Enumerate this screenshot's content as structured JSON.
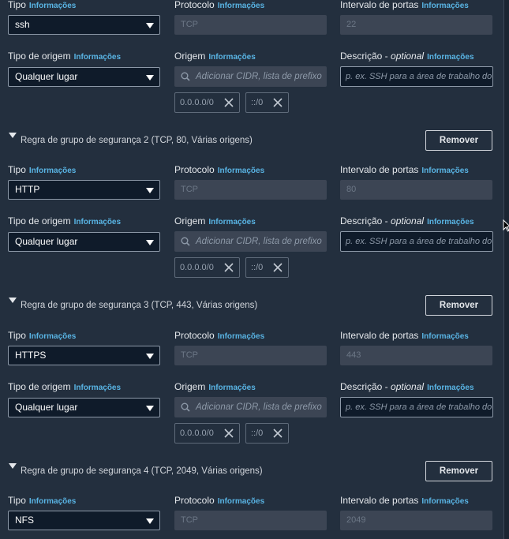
{
  "labels": {
    "tipo": "Tipo",
    "protocolo": "Protocolo",
    "intervalo": "Intervalo de portas",
    "tipo_origem": "Tipo de origem",
    "origem": "Origem",
    "descricao": "Descrição - ",
    "descricao_optional": "optional",
    "info": "Informações"
  },
  "common": {
    "origin_type": "Qualquer lugar",
    "cidr_placeholder": "Adicionar CIDR, lista de prefixo",
    "desc_placeholder": "p. ex. SSH para a área de trabalho do",
    "chip_ipv4": "0.0.0.0/0",
    "chip_ipv6": "::/0",
    "remove_label": "Remover"
  },
  "rules": [
    {
      "section_title": "",
      "type": "ssh",
      "protocol": "TCP",
      "port": "22"
    },
    {
      "section_title": "Regra de grupo de segurança 2 (TCP, 80, Várias origens)",
      "type": "HTTP",
      "protocol": "TCP",
      "port": "80"
    },
    {
      "section_title": "Regra de grupo de segurança 3 (TCP, 443, Várias origens)",
      "type": "HTTPS",
      "protocol": "TCP",
      "port": "443"
    },
    {
      "section_title": "Regra de grupo de segurança 4 (TCP, 2049, Várias origens)",
      "type": "NFS",
      "protocol": "TCP",
      "port": "2049"
    }
  ]
}
